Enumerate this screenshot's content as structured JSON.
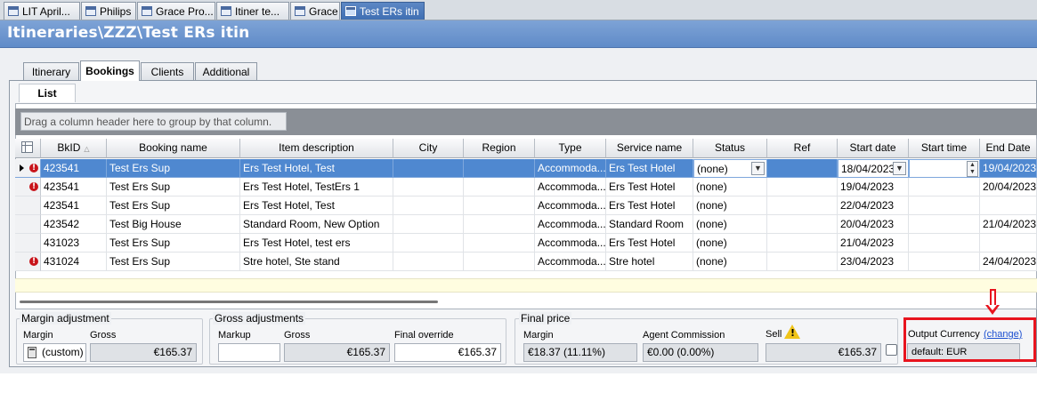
{
  "doc_tabs": [
    {
      "label": "LIT April..."
    },
    {
      "label": "Philips"
    },
    {
      "label": "Grace Pro..."
    },
    {
      "label": "Itiner te..."
    },
    {
      "label": "Grace"
    },
    {
      "label": "Test ERs itin",
      "active": true
    }
  ],
  "title": "Itineraries\\ZZZ\\Test ERs itin",
  "tabs": [
    {
      "label": "Itinerary"
    },
    {
      "label": "Bookings",
      "active": true
    },
    {
      "label": "Clients"
    },
    {
      "label": "Additional"
    }
  ],
  "subtab": "List",
  "group_hint": "Drag a column header here to group by that column.",
  "columns": [
    "BkID",
    "Booking name",
    "Item description",
    "City",
    "Region",
    "Type",
    "Service name",
    "Status",
    "Ref",
    "Start date",
    "Start time",
    "End Date"
  ],
  "rows": [
    {
      "warn": true,
      "selected": true,
      "bkid": "423541",
      "booking_name": "Test Ers Sup",
      "item_description": "Ers Test Hotel, Test",
      "city": "",
      "region": "",
      "type": "Accommoda...",
      "service_name": "Ers Test Hotel",
      "status": "(none)",
      "ref": "",
      "start_date": "18/04/2023",
      "start_time": "",
      "end_date": "19/04/2023"
    },
    {
      "warn": true,
      "selected": false,
      "bkid": "423541",
      "booking_name": "Test Ers Sup",
      "item_description": "Ers Test Hotel, TestErs 1",
      "city": "",
      "region": "",
      "type": "Accommoda...",
      "service_name": "Ers Test Hotel",
      "status": "(none)",
      "ref": "",
      "start_date": "19/04/2023",
      "start_time": "",
      "end_date": "20/04/2023"
    },
    {
      "warn": false,
      "selected": false,
      "bkid": "423541",
      "booking_name": "Test Ers Sup",
      "item_description": "Ers Test Hotel, Test",
      "city": "",
      "region": "",
      "type": "Accommoda...",
      "service_name": "Ers Test Hotel",
      "status": "(none)",
      "ref": "",
      "start_date": "22/04/2023",
      "start_time": "",
      "end_date": ""
    },
    {
      "warn": false,
      "selected": false,
      "bkid": "423542",
      "booking_name": "Test Big House",
      "item_description": "Standard Room, New Option",
      "city": "",
      "region": "",
      "type": "Accommoda...",
      "service_name": "Standard Room",
      "status": "(none)",
      "ref": "",
      "start_date": "20/04/2023",
      "start_time": "",
      "end_date": "21/04/2023"
    },
    {
      "warn": false,
      "selected": false,
      "bkid": "431023",
      "booking_name": "Test Ers Sup",
      "item_description": "Ers Test Hotel, test ers",
      "city": "",
      "region": "",
      "type": "Accommoda...",
      "service_name": "Ers Test Hotel",
      "status": "(none)",
      "ref": "",
      "start_date": "21/04/2023",
      "start_time": "",
      "end_date": ""
    },
    {
      "warn": true,
      "selected": false,
      "bkid": "431024",
      "booking_name": "Test Ers Sup",
      "item_description": "Stre hotel, Ste stand",
      "city": "",
      "region": "",
      "type": "Accommoda...",
      "service_name": "Stre hotel",
      "status": "(none)",
      "ref": "",
      "start_date": "23/04/2023",
      "start_time": "",
      "end_date": "24/04/2023"
    }
  ],
  "margin_adjustment": {
    "title": "Margin adjustment",
    "margin_label": "Margin",
    "gross_label": "Gross",
    "margin_value": "(custom)",
    "gross_value": "€165.37"
  },
  "gross_adjustments": {
    "title": "Gross adjustments",
    "markup_label": "Markup",
    "gross_label": "Gross",
    "final_override_label": "Final override",
    "markup_value": "",
    "gross_value": "€165.37",
    "final_override_value": "€165.37"
  },
  "final_price": {
    "title": "Final price",
    "margin_label": "Margin",
    "agent_commission_label": "Agent Commission",
    "sell_label": "Sell",
    "margin_value": "€18.37 (11.11%)",
    "agent_commission_value": "€0.00 (0.00%)",
    "sell_value": "€165.37"
  },
  "output_currency": {
    "label": "Output Currency",
    "change_link": "(change)",
    "value": "default: EUR"
  },
  "colors": {
    "selected_row": "#4f88d0",
    "title_bar": "#6f97cf",
    "warning": "#c8141b",
    "highlight": "#e8141e"
  },
  "icons": {
    "doc_tab": "window-icon",
    "row_warning": "exclamation-circle-icon",
    "sell_warning": "warning-triangle-icon",
    "margin_calc": "calculator-icon"
  }
}
